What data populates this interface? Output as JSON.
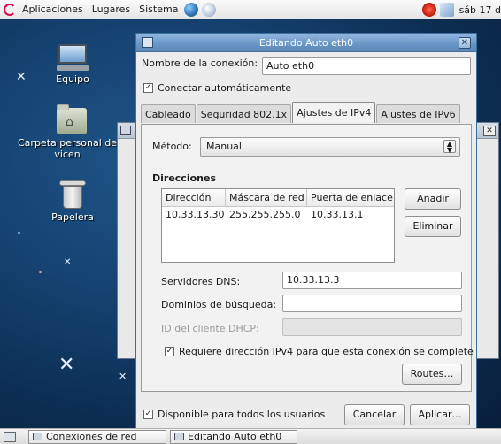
{
  "top_panel": {
    "menus": [
      "Aplicaciones",
      "Lugares",
      "Sistema"
    ],
    "clock": "sáb 17 d"
  },
  "desktop": {
    "icons": [
      {
        "label": "Equipo"
      },
      {
        "label": "Carpeta personal de vicen"
      },
      {
        "label": "Papelera"
      }
    ]
  },
  "dialog": {
    "title": "Editando Auto eth0",
    "connection_name_label": "Nombre de la conexión:",
    "connection_name_value": "Auto eth0",
    "auto_connect_label": "Conectar automáticamente",
    "tabs": [
      "Cableado",
      "Seguridad 802.1x",
      "Ajustes de IPv4",
      "Ajustes de IPv6"
    ],
    "active_tab": "Ajustes de IPv4",
    "method_label": "Método:",
    "method_value": "Manual",
    "addresses_title": "Direcciones",
    "addresses_columns": [
      "Dirección",
      "Máscara de red",
      "Puerta de enlace"
    ],
    "addresses_rows": [
      [
        "10.33.13.30",
        "255.255.255.0",
        "10.33.13.1"
      ]
    ],
    "add_button": "Añadir",
    "delete_button": "Eliminar",
    "dns_label": "Servidores DNS:",
    "dns_value": "10.33.13.3",
    "search_domains_label": "Dominios de búsqueda:",
    "search_domains_value": "",
    "dhcp_client_label": "ID del cliente DHCP:",
    "dhcp_client_value": "",
    "require_ipv4_label": "Requiere dirección IPv4 para que esta conexión se complete",
    "routes_button": "Routes…",
    "available_all_label": "Disponible para todos los usuarios",
    "cancel_button": "Cancelar",
    "apply_button": "Aplicar…"
  },
  "taskbar": {
    "tasks": [
      "Conexiones de red",
      "Editando Auto eth0"
    ]
  }
}
